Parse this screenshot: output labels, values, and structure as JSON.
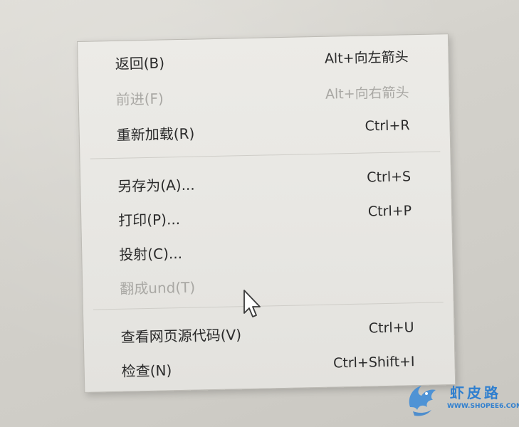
{
  "context_menu": {
    "items": [
      {
        "label": "返回(B)",
        "shortcut": "Alt+向左箭头",
        "enabled": true
      },
      {
        "label": "前进(F)",
        "shortcut": "Alt+向右箭头",
        "enabled": false
      },
      {
        "label": "重新加载(R)",
        "shortcut": "Ctrl+R",
        "enabled": true
      },
      {
        "label": "另存为(A)...",
        "shortcut": "Ctrl+S",
        "enabled": true
      },
      {
        "label": "打印(P)...",
        "shortcut": "Ctrl+P",
        "enabled": true
      },
      {
        "label": "投射(C)...",
        "shortcut": "",
        "enabled": true
      },
      {
        "label": "翻成und(T)",
        "shortcut": "",
        "enabled": false
      },
      {
        "label": "查看网页源代码(V)",
        "shortcut": "Ctrl+U",
        "enabled": true
      },
      {
        "label": "检查(N)",
        "shortcut": "Ctrl+Shift+I",
        "enabled": true
      }
    ]
  },
  "watermark": {
    "name": "虾皮路",
    "url": "WWW.SHOPEE6.COM",
    "color": "#2f7fcf"
  },
  "cursor": {
    "icon": "arrow-pointer-icon"
  }
}
